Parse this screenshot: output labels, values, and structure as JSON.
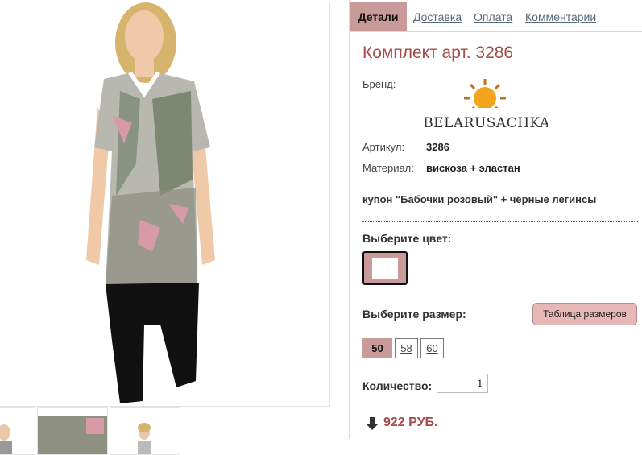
{
  "tabs": {
    "active": "Детали",
    "links": [
      "Доставка",
      "Оплата",
      "Комментарии"
    ]
  },
  "product": {
    "title": "Комплект арт. 3286",
    "brand_label": "Бренд:",
    "brand_name": "BELARUSACHKA",
    "article_label": "Артикул:",
    "article_value": "3286",
    "material_label": "Материал:",
    "material_value": "вискоза + эластан",
    "description": "купон \"Бабочки розовый\" + чёрные легинсы"
  },
  "color": {
    "label": "Выберите цвет:",
    "swatch_color": "#c99a9a"
  },
  "size": {
    "label": "Выберите размер:",
    "table_button": "Таблица размеров",
    "options": [
      "50",
      "58",
      "60"
    ],
    "selected": "50"
  },
  "quantity": {
    "label": "Количество:",
    "value": "1"
  },
  "price": {
    "amount": "922 РУБ.",
    "icon": "arrow-down-icon"
  },
  "colors": {
    "accent": "#c99a9a",
    "title": "#a64b4b",
    "link": "#5a6b7a"
  }
}
